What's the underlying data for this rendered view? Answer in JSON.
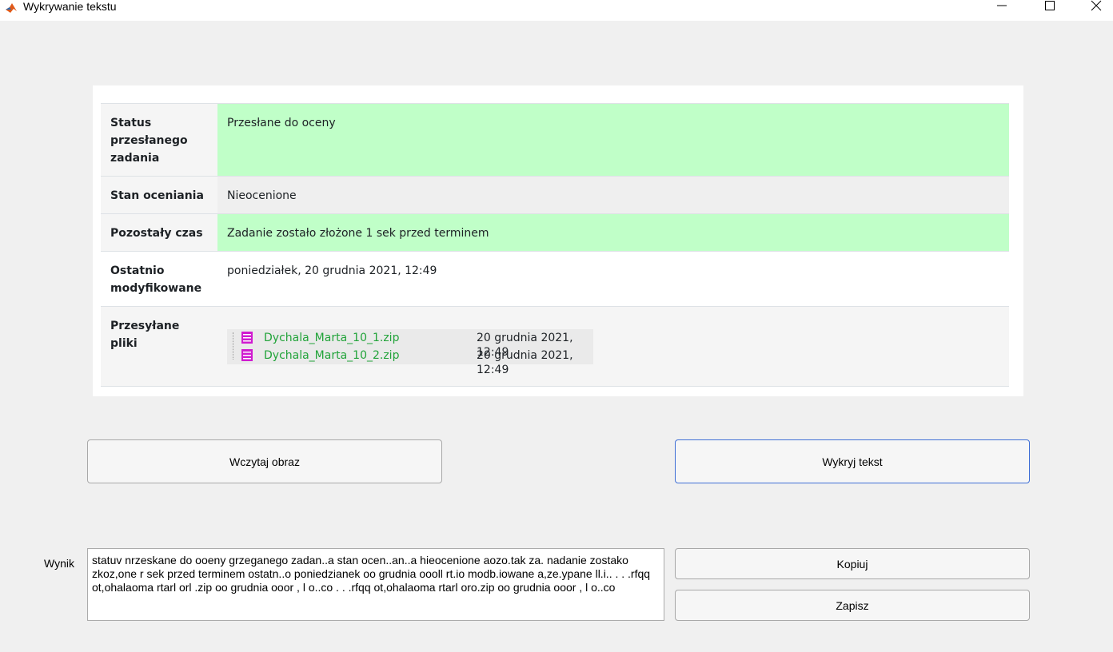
{
  "window": {
    "title": "Wykrywanie tekstu",
    "icons": [
      "matlab-logo-icon",
      "minimize-icon",
      "maximize-icon",
      "close-icon"
    ]
  },
  "image_panel": {
    "rows": [
      {
        "label": "Status przesłanego zadania",
        "value": "Przesłane do oceny"
      },
      {
        "label": "Stan oceniania",
        "value": "Nieocenione"
      },
      {
        "label": "Pozostały czas",
        "value": "Zadanie zostało złożone 1 sek przed terminem"
      },
      {
        "label": "Ostatnio modyfikowane",
        "value": "poniedziałek, 20 grudnia 2021, 12:49"
      },
      {
        "label": "Przesyłane pliki",
        "value": ""
      }
    ],
    "files": [
      {
        "name": "Dychala_Marta_10_1.zip",
        "date": "20 grudnia 2021, 12:49"
      },
      {
        "name": "Dychala_Marta_10_2.zip",
        "date": "20 grudnia 2021, 12:49"
      }
    ],
    "colors": {
      "submitted": "#c0ffc8",
      "file_link": "#21a339"
    }
  },
  "buttons": {
    "load": "Wczytaj obraz",
    "detect": "Wykryj tekst",
    "copy": "Kopiuj",
    "save": "Zapisz"
  },
  "result": {
    "label": "Wynik",
    "text": "statuv nrzeskane do ooeny grzeganego zadan..a stan ocen..an..a hieocenione aozo.tak za. nadanie zostako zkoz,one r sek przed terminem ostatn..o poniedzianek oo grudnia oooll rt.io modb.iowane a,ze.ypane ll.i.. . . .rfqq ot,ohalaoma rtarl orl .zip oo grudnia ooor , l o..co . . .rfqq ot,ohalaoma rtarl oro.zip oo grudnia ooor , l o..co"
  }
}
